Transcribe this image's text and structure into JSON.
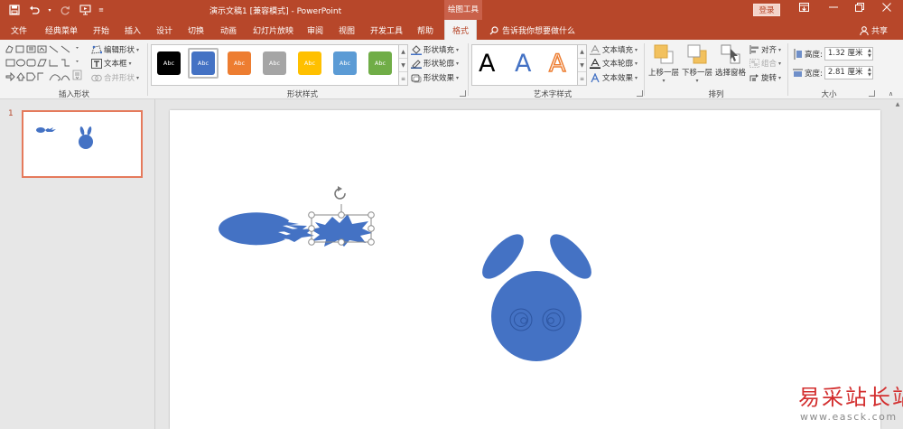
{
  "titlebar": {
    "doc_title": "演示文稿1 [兼容模式] - PowerPoint",
    "context_tools": "绘图工具",
    "login": "登录"
  },
  "tabs": [
    "文件",
    "经典菜单",
    "开始",
    "插入",
    "设计",
    "切换",
    "动画",
    "幻灯片放映",
    "审阅",
    "视图",
    "开发工具",
    "帮助",
    "格式"
  ],
  "active_tab": "格式",
  "tell_me": "告诉我你想要做什么",
  "share": "共享",
  "ribbon": {
    "insert_shapes": {
      "label": "插入形状",
      "edit_shape": "编辑形状",
      "text_box": "文本框",
      "merge_shapes": "合并形状"
    },
    "shape_styles": {
      "label": "形状样式",
      "swatch_text": "Abc",
      "swatches": [
        "#000000",
        "#4472c4",
        "#ed7d31",
        "#a5a5a5",
        "#ffc000",
        "#5b9bd5",
        "#70ad47"
      ],
      "fill": "形状填充",
      "outline": "形状轮廓",
      "effects": "形状效果"
    },
    "wordart": {
      "label": "艺术字样式",
      "letter": "A",
      "text_fill": "文本填充",
      "text_outline": "文本轮廓",
      "text_effects": "文本效果"
    },
    "arrange": {
      "label": "排列",
      "bring_forward": "上移一层",
      "send_backward": "下移一层",
      "selection_pane": "选择窗格",
      "align": "对齐",
      "group": "组合",
      "rotate": "旋转"
    },
    "size": {
      "label": "大小",
      "height_label": "高度:",
      "height_value": "1.32 厘米",
      "width_label": "宽度:",
      "width_value": "2.81 厘米"
    }
  },
  "slide_panel": {
    "slide_number": "1"
  },
  "colors": {
    "accent": "#b7472a",
    "shape_blue": "#4472c4"
  },
  "watermark": {
    "main": "易采站长站",
    "url": "www.easck.com"
  }
}
